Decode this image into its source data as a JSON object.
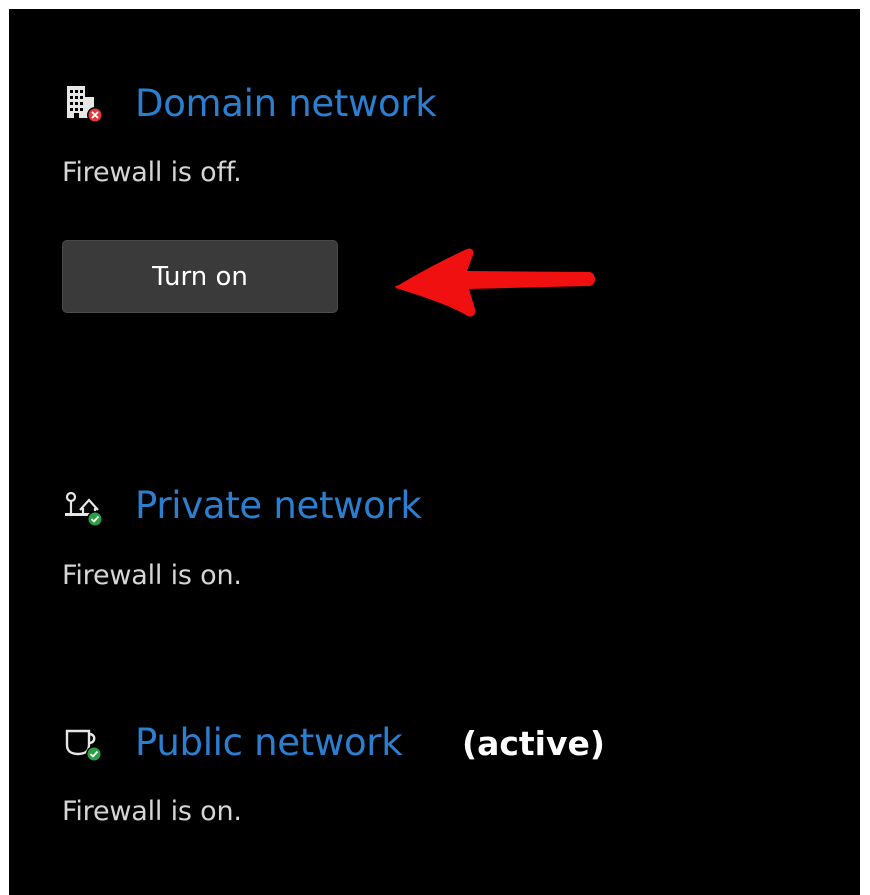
{
  "colors": {
    "background": "#000000",
    "link": "#2a7fd0",
    "text": "#d6d6d6",
    "active_label": "#ffffff",
    "button_bg": "#3a3a3a",
    "button_text": "#ffffff",
    "arrow": "#f01010",
    "error_badge": "#e23a3a",
    "ok_badge": "#2e9e45"
  },
  "networks": [
    {
      "title": "Domain network",
      "status": "Firewall is off.",
      "icon": "building-error-icon",
      "button_label": "Turn on"
    },
    {
      "title": "Private network",
      "status": "Firewall is on.",
      "icon": "private-network-ok-icon"
    },
    {
      "title": "Public network",
      "suffix": "(active)",
      "status": "Firewall is on.",
      "icon": "coffee-cup-ok-icon"
    }
  ],
  "annotation": {
    "icon": "red-arrow-left-icon"
  }
}
